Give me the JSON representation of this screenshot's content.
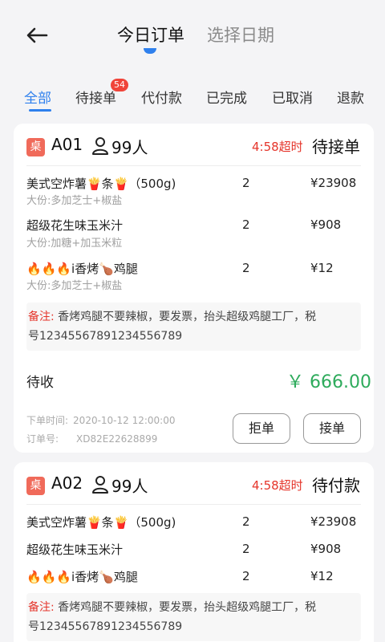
{
  "header": {
    "tab_today": "今日订单",
    "tab_date": "选择日期",
    "back_icon": "back-arrow-icon",
    "accent": "#2f80ed"
  },
  "filters": {
    "tabs": [
      "全部",
      "待接单",
      "代付款",
      "已完成",
      "已取消",
      "退款"
    ],
    "active": "全部",
    "pending_badge": "54"
  },
  "orders": [
    {
      "desk_label": "桌",
      "table_no": "A01",
      "people": "99人",
      "overtime": "4:58超时",
      "status": "待接单",
      "items": [
        {
          "name": "美式空炸薯🍟条🍟（500g)",
          "sub": "大份:多加芝士+椒盐",
          "qty": "2",
          "price": "¥23908"
        },
        {
          "name": "超级花生味玉米汁",
          "sub": "大份:加糖+加玉米粒",
          "qty": "2",
          "price": "¥908"
        },
        {
          "name": "🔥🔥🔥i香烤🍗鸡腿",
          "sub": "大份:多加芝士+椒盐",
          "qty": "2",
          "price": "¥12"
        }
      ],
      "remark_label": "备注:",
      "remark_line1": "香烤鸡腿不要辣椒，要发票，抬头超级鸡腿工厂，税",
      "remark_line2": "号12345567891234556789",
      "receivable_label": "待收",
      "receivable_amount": "￥ 666.00",
      "order_time_label": "下单时间:",
      "order_time": "2020-10-12 12:00:00",
      "order_no_label": "订单号:",
      "order_no": "XD82E22628899",
      "reject_label": "拒单",
      "accept_label": "接单"
    },
    {
      "desk_label": "桌",
      "table_no": "A02",
      "people": "99人",
      "overtime": "4:58超时",
      "status": "待付款",
      "items": [
        {
          "name": "美式空炸薯🍟条🍟（500g)",
          "qty": "2",
          "price": "¥23908"
        },
        {
          "name": "超级花生味玉米汁",
          "qty": "2",
          "price": "¥908"
        },
        {
          "name": "🔥🔥🔥i香烤🍗鸡腿",
          "qty": "2",
          "price": "¥12"
        }
      ],
      "remark_label": "备注:",
      "remark_line1": "香烤鸡腿不要辣椒，要发票，抬头超级鸡腿工厂，税",
      "remark_line2": "号12345567891234556789"
    }
  ]
}
